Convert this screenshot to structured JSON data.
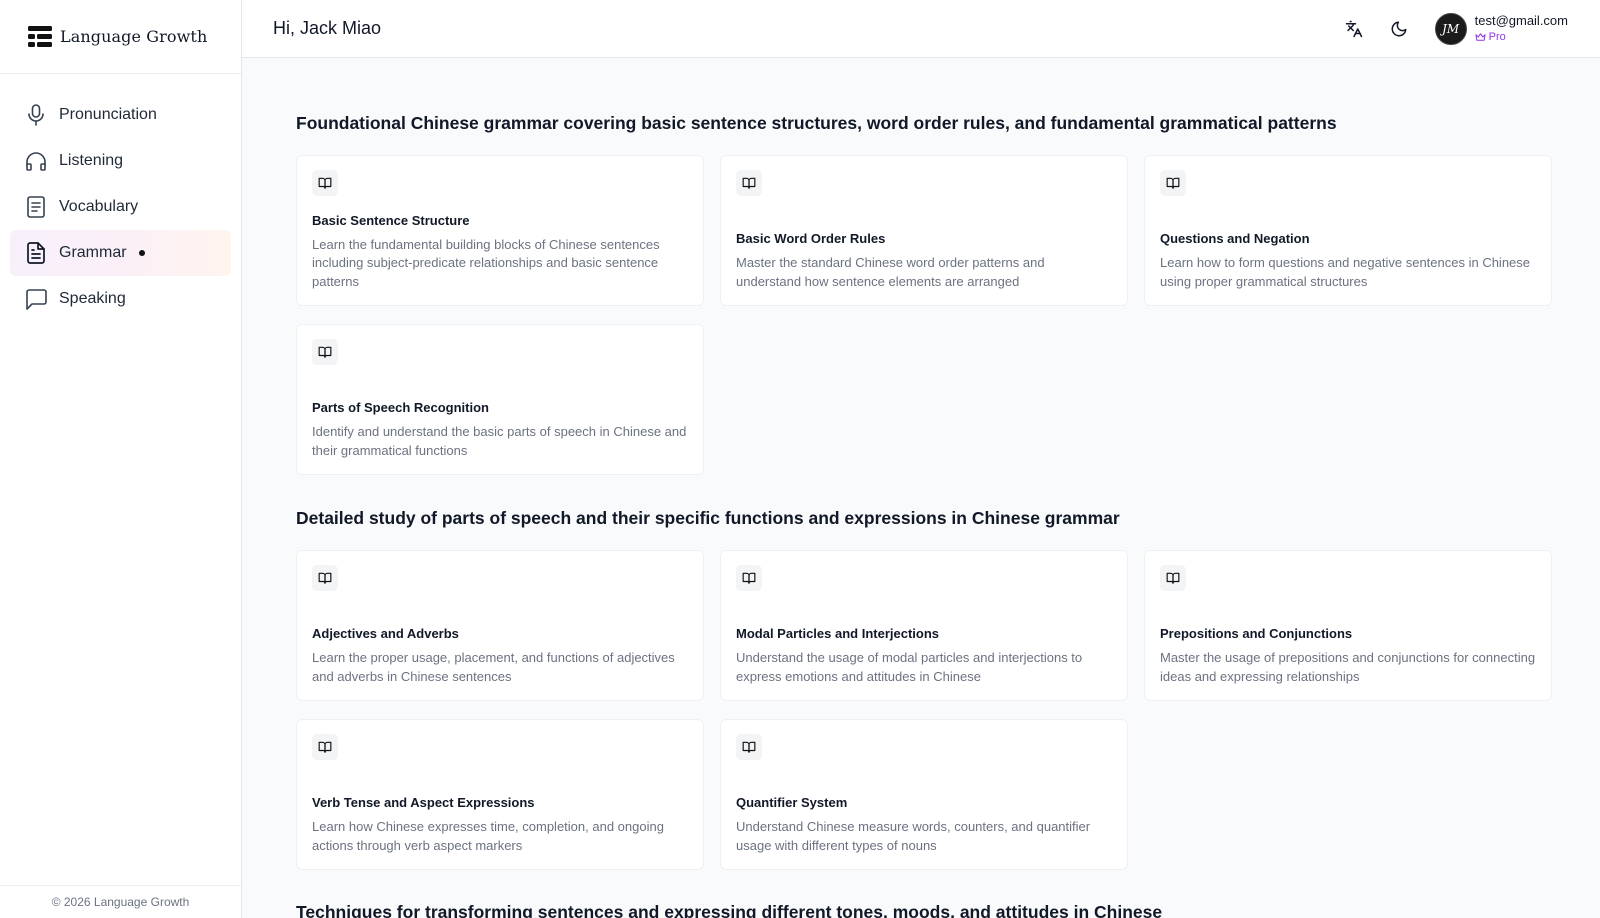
{
  "brand": {
    "name": "Language Growth"
  },
  "sidebar": {
    "items": [
      {
        "label": "Pronunciation",
        "icon": "microphone-icon",
        "active": false
      },
      {
        "label": "Listening",
        "icon": "headphones-icon",
        "active": false
      },
      {
        "label": "Vocabulary",
        "icon": "document-icon",
        "active": false
      },
      {
        "label": "Grammar",
        "icon": "file-text-icon",
        "active": true
      },
      {
        "label": "Speaking",
        "icon": "message-square-icon",
        "active": false
      }
    ],
    "footer": "© 2026 Language Growth"
  },
  "header": {
    "greeting": "Hi, Jack Miao",
    "user": {
      "email": "test@gmail.com",
      "plan": "Pro",
      "avatar_initials": "JM"
    }
  },
  "sections": [
    {
      "title": "Foundational Chinese grammar covering basic sentence structures, word order rules, and fundamental grammatical patterns",
      "cards": [
        {
          "title": "Basic Sentence Structure",
          "description": "Learn the fundamental building blocks of Chinese sentences including subject-predicate relationships and basic sentence patterns"
        },
        {
          "title": "Basic Word Order Rules",
          "description": "Master the standard Chinese word order patterns and understand how sentence elements are arranged"
        },
        {
          "title": "Questions and Negation",
          "description": "Learn how to form questions and negative sentences in Chinese using proper grammatical structures"
        },
        {
          "title": "Parts of Speech Recognition",
          "description": "Identify and understand the basic parts of speech in Chinese and their grammatical functions"
        }
      ]
    },
    {
      "title": "Detailed study of parts of speech and their specific functions and expressions in Chinese grammar",
      "cards": [
        {
          "title": "Adjectives and Adverbs",
          "description": "Learn the proper usage, placement, and functions of adjectives and adverbs in Chinese sentences"
        },
        {
          "title": "Modal Particles and Interjections",
          "description": "Understand the usage of modal particles and interjections to express emotions and attitudes in Chinese"
        },
        {
          "title": "Prepositions and Conjunctions",
          "description": "Master the usage of prepositions and conjunctions for connecting ideas and expressing relationships"
        },
        {
          "title": "Verb Tense and Aspect Expressions",
          "description": "Learn how Chinese expresses time, completion, and ongoing actions through verb aspect markers"
        },
        {
          "title": "Quantifier System",
          "description": "Understand Chinese measure words, counters, and quantifier usage with different types of nouns"
        }
      ]
    },
    {
      "title": "Techniques for transforming sentences and expressing different tones, moods, and attitudes in Chinese",
      "cards": []
    }
  ],
  "colors": {
    "accent": "#9333ea",
    "active_gradient_start": "#f7f0fb",
    "active_gradient_end": "#fff4ee"
  }
}
